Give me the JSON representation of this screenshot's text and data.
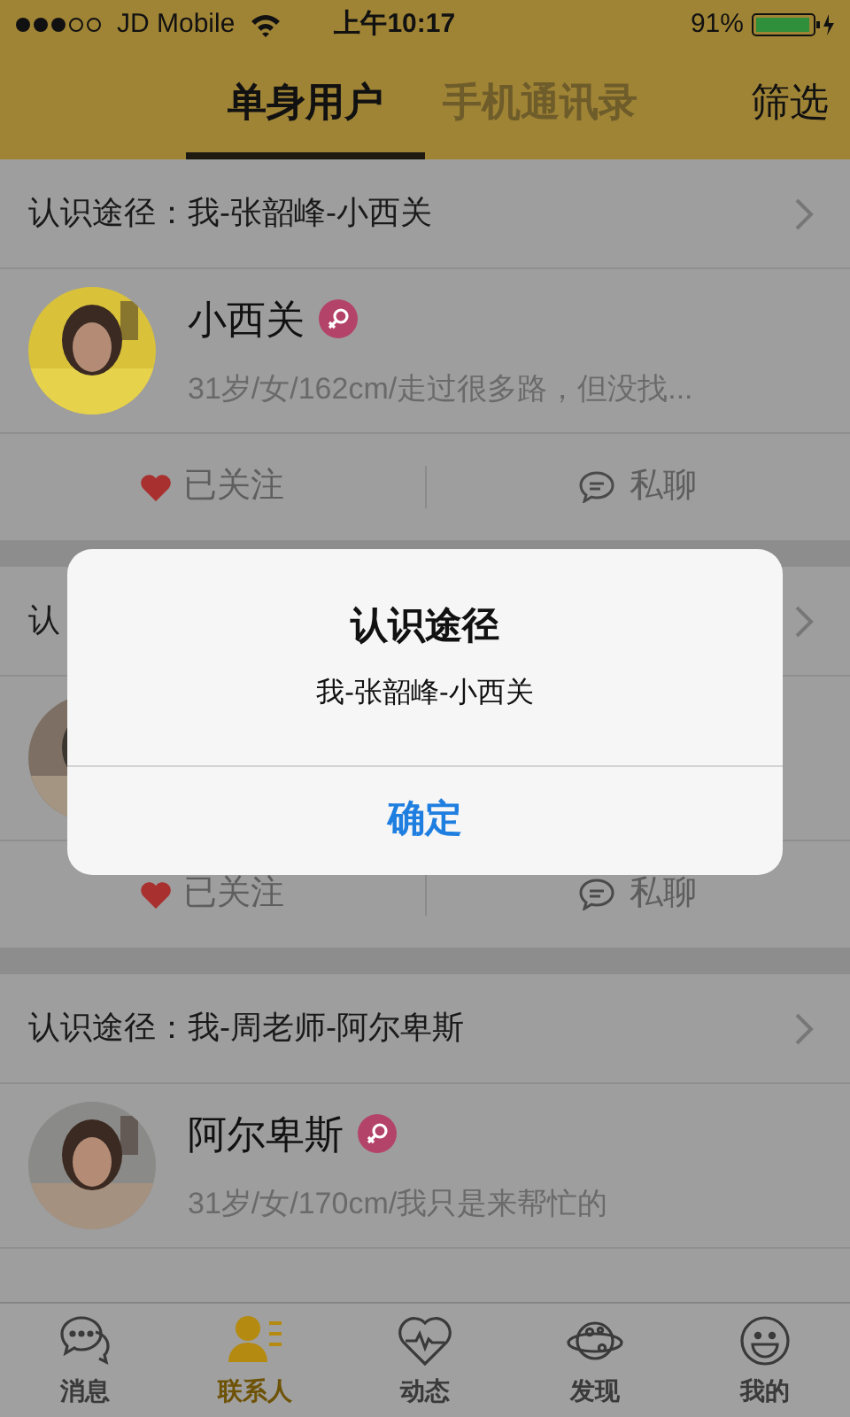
{
  "status_bar": {
    "carrier": "JD Mobile",
    "time": "上午10:17",
    "battery": "91%"
  },
  "header": {
    "tabs": [
      {
        "label": "单身用户",
        "selected": true
      },
      {
        "label": "手机通讯录",
        "selected": false
      }
    ],
    "filter_button": "筛选"
  },
  "contacts": [
    {
      "path": "认识途径：我-张韶峰-小西关",
      "name": "小西关",
      "description": "31岁/女/162cm/走过很多路，但没找...",
      "follow": "已关注",
      "chat": "私聊"
    },
    {
      "path": "认",
      "follow": "已关注",
      "chat": "私聊"
    },
    {
      "path": "认识途径：我-周老师-阿尔卑斯",
      "name": "阿尔卑斯",
      "description": "31岁/女/170cm/我只是来帮忙的"
    }
  ],
  "alert": {
    "title": "认识途径",
    "message": "我-张韶峰-小西关",
    "button": "确定"
  },
  "tab_bar": [
    {
      "label": "消息",
      "selected": false
    },
    {
      "label": "联系人",
      "selected": true
    },
    {
      "label": "动态",
      "selected": false
    },
    {
      "label": "发现",
      "selected": false
    },
    {
      "label": "我的",
      "selected": false
    }
  ]
}
